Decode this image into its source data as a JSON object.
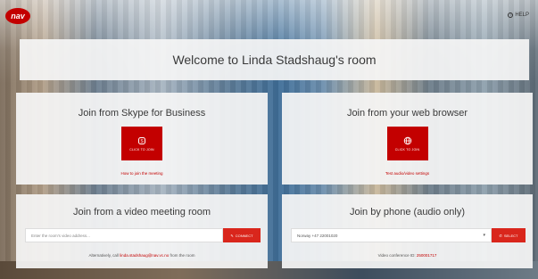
{
  "app": {
    "logo_text": "nav",
    "help_label": "HELP"
  },
  "welcome": {
    "title": "Welcome to Linda Stadshaug's room"
  },
  "skype": {
    "title": "Join from Skype for Business",
    "button_label": "CLICK TO JOIN",
    "link": "How to join the meeting"
  },
  "web": {
    "title": "Join from your web browser",
    "button_label": "CLICK TO JOIN",
    "link": "Test audio/video settings"
  },
  "video": {
    "title": "Join from a video meeting room",
    "input_placeholder": "Enter the room's video address...",
    "button_label": "CONNECT",
    "note_prefix": "Alternatively, call",
    "note_address": "linda.stadshaug@nav.vc.no",
    "note_suffix": "from the room"
  },
  "phone": {
    "title": "Join by phone (audio only)",
    "selected_number": "Norway +47 22001020",
    "button_label": "SELECT",
    "note_prefix": "Video conference ID:",
    "note_id": "250001717"
  },
  "colors": {
    "brand_red": "#c30000",
    "button_red": "#d9261c"
  }
}
